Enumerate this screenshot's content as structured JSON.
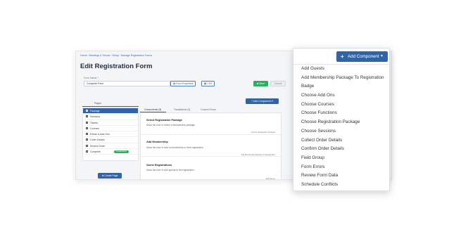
{
  "breadcrumb": [
    "Home",
    "Meetings & Shows",
    "Setup",
    "Manage Registration Forms"
  ],
  "page_title": "Edit Registration Form",
  "form_name": {
    "label": "Form Name *",
    "value": "Complete Form"
  },
  "buttons": {
    "form_properties": "Form Properties",
    "css": "CSS",
    "save": "Save",
    "cancel": "Cancel",
    "add_component_small": "Add Component",
    "create_page": "Create Page",
    "add_component": "Add Component"
  },
  "pages": {
    "label": "Pages",
    "items": [
      "Package",
      "Sessions",
      "Tickets",
      "Courses",
      "Extras & Add-Ons",
      "Order Details",
      "Review Order",
      "Complete"
    ],
    "complete_badge": "Confirmation"
  },
  "tabs": [
    "Components (3)",
    "Translations (3)",
    "Custom Errors"
  ],
  "components": [
    {
      "title": "Select Registration Package",
      "desc": "Allow the user to select a Membership package.",
      "tag": "Choose Registration Package"
    },
    {
      "title": "Add Membership",
      "desc": "Allow the user to add a membership to their registration.",
      "tag": "Add Membership Package To Registration"
    },
    {
      "title": "Guest Registrations",
      "desc": "Allow the user to add guests to the registration.",
      "tag": "Add Guests"
    }
  ],
  "dropdown_items": [
    "Add Guests",
    "Add Membership Package To Registration",
    "Badge",
    "Choose Add Ons",
    "Choose Courses",
    "Choose Functions",
    "Choose Registration Package",
    "Choose Sessions",
    "Collect Order Details",
    "Confirm Order Details",
    "Field Group",
    "Form Errors",
    "Review Form Data",
    "Schedule Conflicts"
  ],
  "colors": {
    "primary": "#2f64a8",
    "success": "#2eae61"
  }
}
